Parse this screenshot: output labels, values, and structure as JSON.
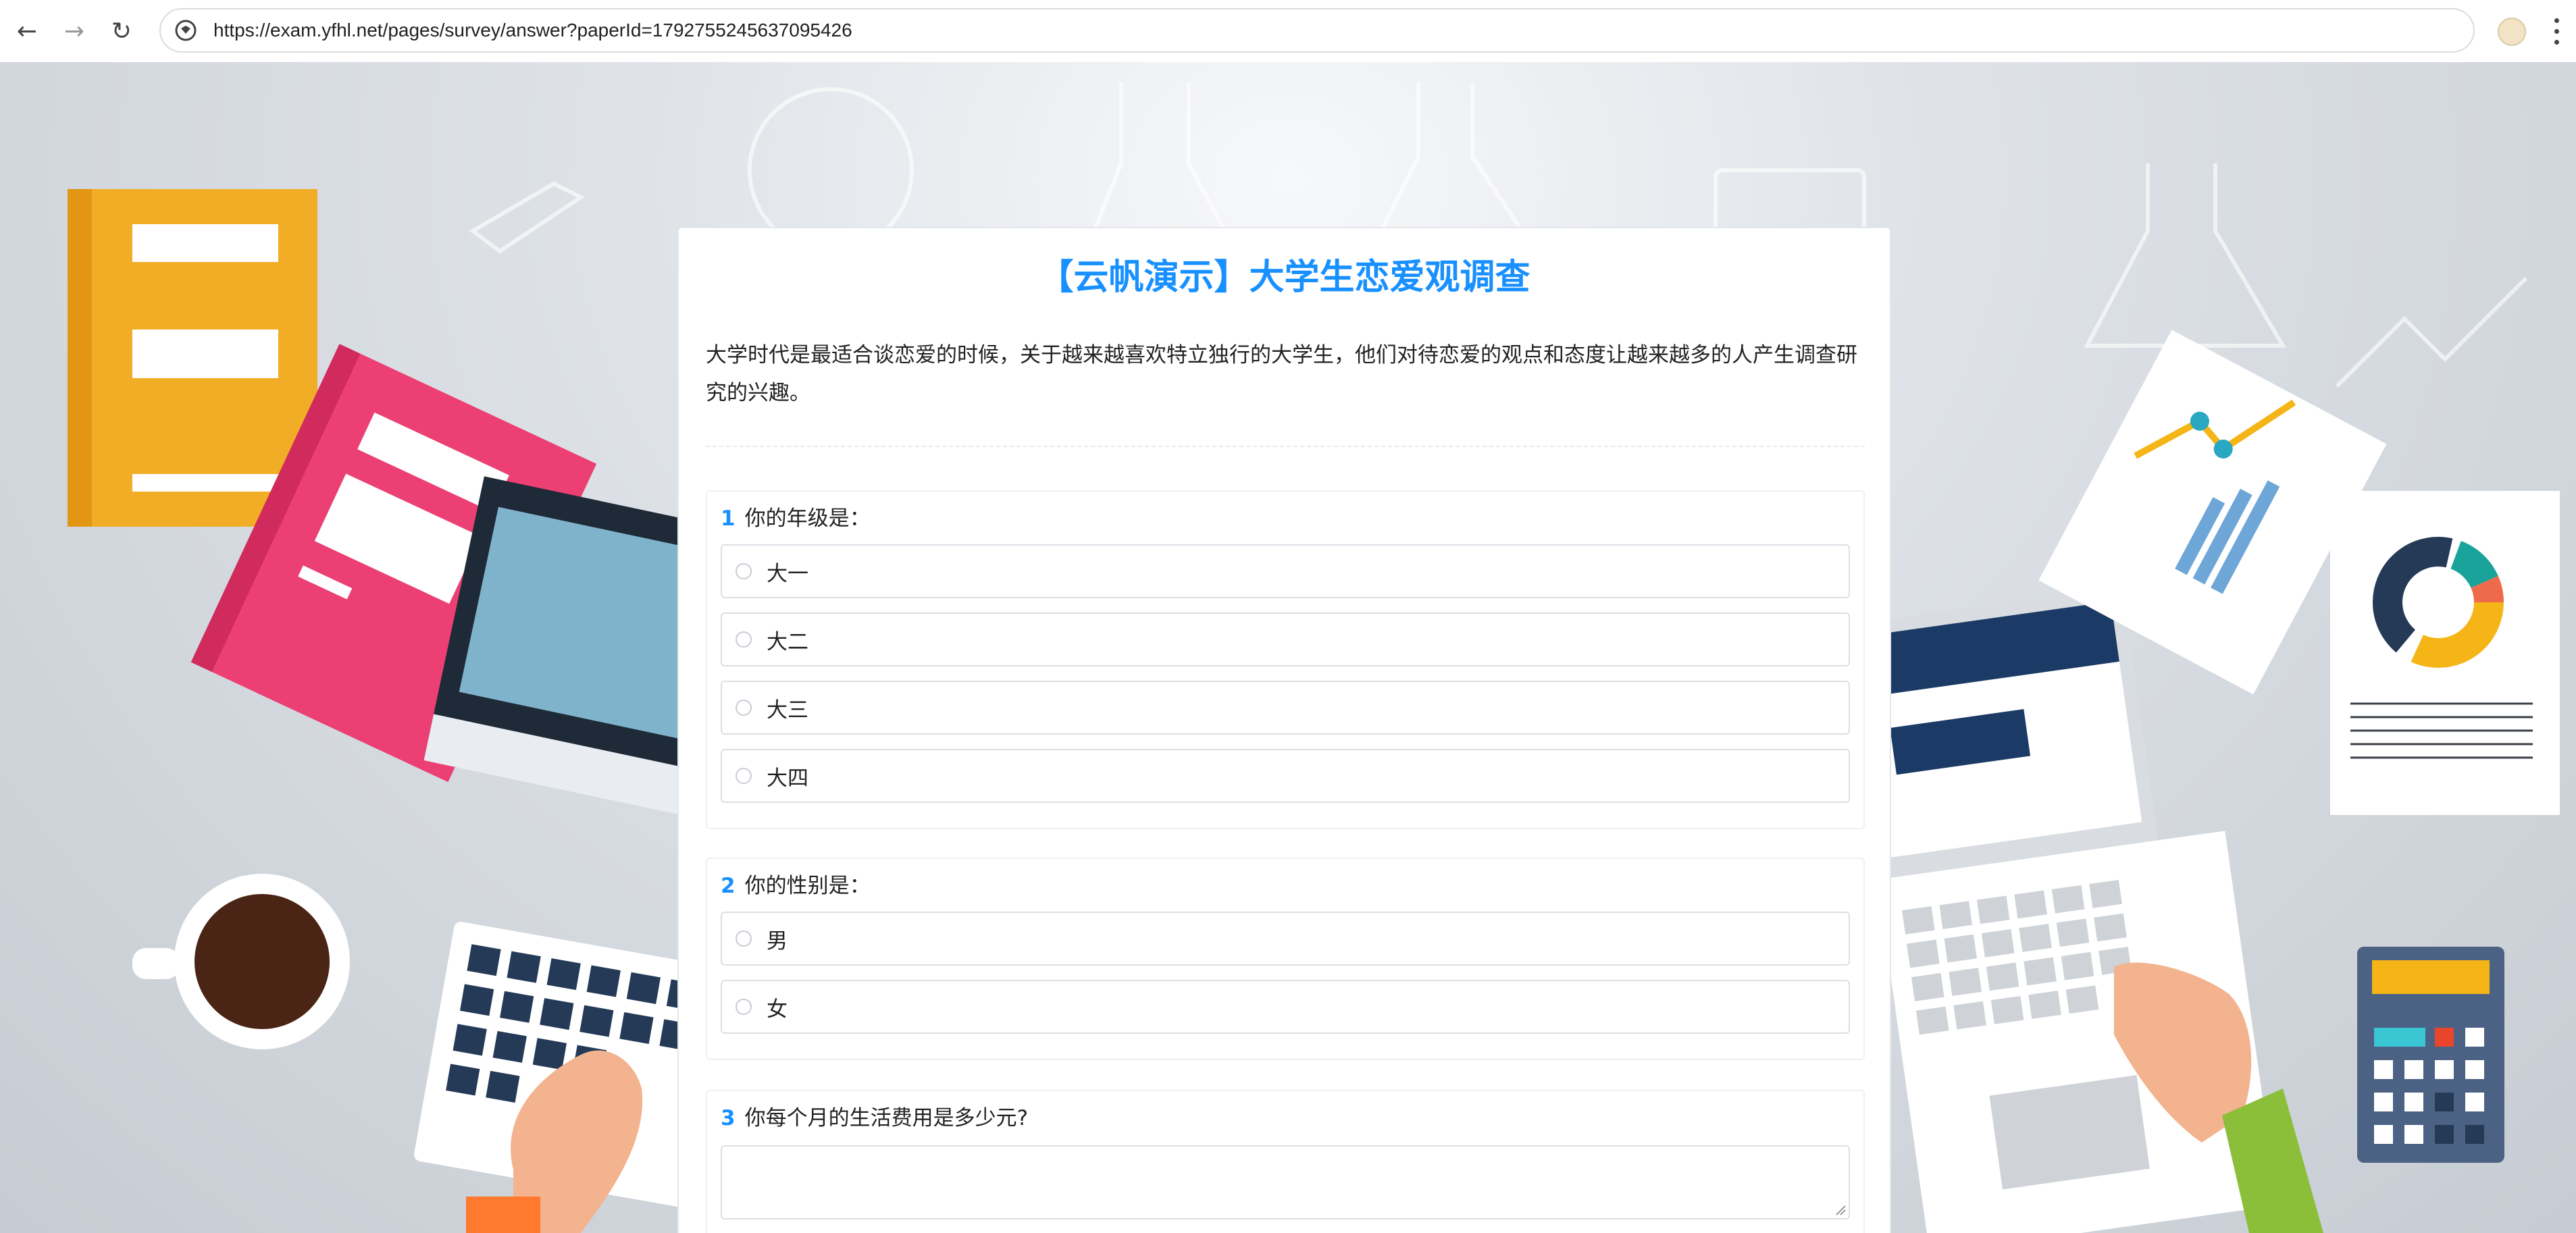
{
  "browser": {
    "url": "https://exam.yfhl.net/pages/survey/answer?paperId=1792755245637095426",
    "back_icon": "←",
    "forward_icon": "→",
    "reload_icon": "↻"
  },
  "survey": {
    "title": "【云帆演示】大学生恋爱观调查",
    "description": "大学时代是最适合谈恋爱的时候，关于越来越喜欢特立独行的大学生，他们对待恋爱的观点和态度让越来越多的人产生调查研究的兴趣。",
    "questions": [
      {
        "number": "1",
        "text": "你的年级是：",
        "options": [
          "大一",
          "大二",
          "大三",
          "大四"
        ]
      },
      {
        "number": "2",
        "text": "你的性别是：",
        "options": [
          "男",
          "女"
        ]
      },
      {
        "number": "3",
        "text": "你每个月的生活费用是多少元?",
        "answer_value": ""
      }
    ]
  },
  "colors": {
    "accent": "#1890ff",
    "border": "#dcdfe6"
  }
}
